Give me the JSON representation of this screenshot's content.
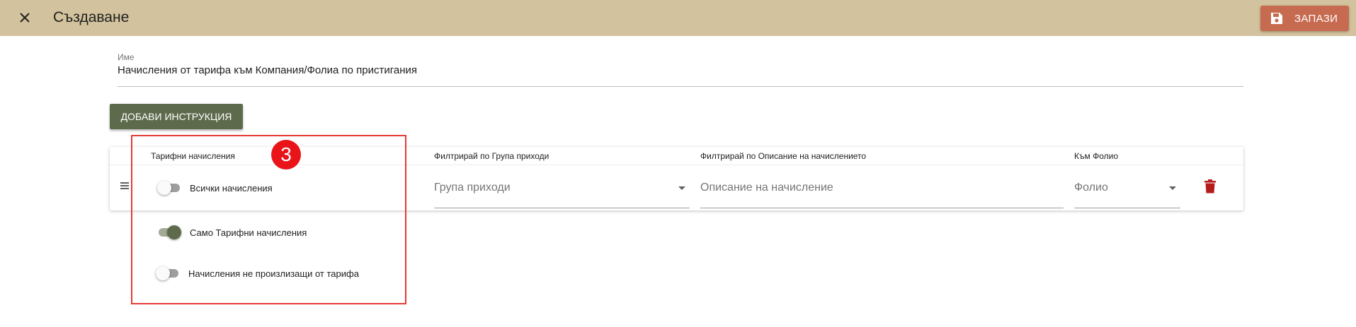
{
  "header": {
    "title": "Създаване",
    "save_label": "ЗАПАЗИ",
    "bar_color": "#d2c29d",
    "save_color": "#c76b50"
  },
  "form": {
    "name_label": "Име",
    "name_value": "Начисления от тарифа към Компания/Фолиа по пристигания",
    "add_instruction_label": "ДОБАВИ ИНСТРУКЦИЯ"
  },
  "table": {
    "columns": [
      "Тарифни начисления",
      "Филтрирай по Група приходи",
      "Филтрирай по Описание на начислението",
      "Към Фолио"
    ],
    "row": {
      "revenue_group_placeholder": "Група приходи",
      "description_placeholder": "Описание на начисление",
      "folio_placeholder": "Фолио"
    }
  },
  "charge_options": [
    {
      "label": "Всички начисления",
      "on": false
    },
    {
      "label": "Само Тарифни начисления",
      "on": true
    },
    {
      "label": "Начисления не произлизащи от тарифа",
      "on": false
    }
  ],
  "annotation": {
    "step": "3",
    "color": "#e53935"
  },
  "icons": {
    "close": "close-icon",
    "save": "floppy-disk-icon",
    "drag": "drag-handle-icon",
    "delete": "trash-icon",
    "caret": "chevron-down-icon"
  }
}
